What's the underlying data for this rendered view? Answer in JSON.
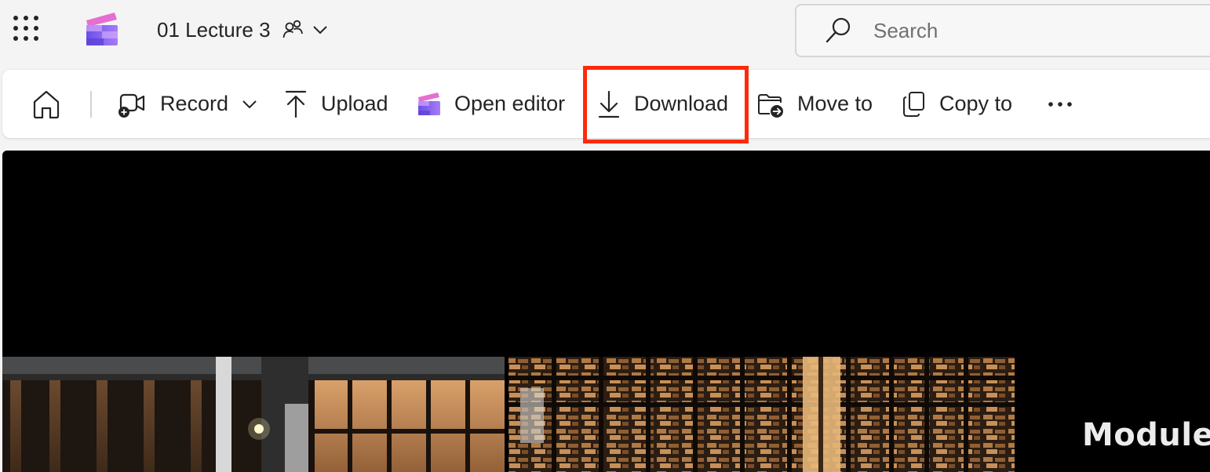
{
  "app": {
    "title": "01 Lecture 3",
    "launcher_icon": "waffle-grid-icon",
    "logo_icon": "clipchamp-logo-icon",
    "brand_colors": [
      "#7a5cf0",
      "#b37ff7",
      "#e06bd0"
    ]
  },
  "search": {
    "placeholder": "Search",
    "icon": "search-icon"
  },
  "toolbar": {
    "home_icon": "home-icon",
    "record_label": "Record",
    "upload_label": "Upload",
    "open_editor_label": "Open editor",
    "download_label": "Download",
    "move_to_label": "Move to",
    "copy_to_label": "Copy to",
    "more_icon": "more-options-icon"
  },
  "annotation": {
    "highlighted_item": "Download",
    "color": "#ff2a0a"
  },
  "video": {
    "overlay_text": "Module"
  }
}
